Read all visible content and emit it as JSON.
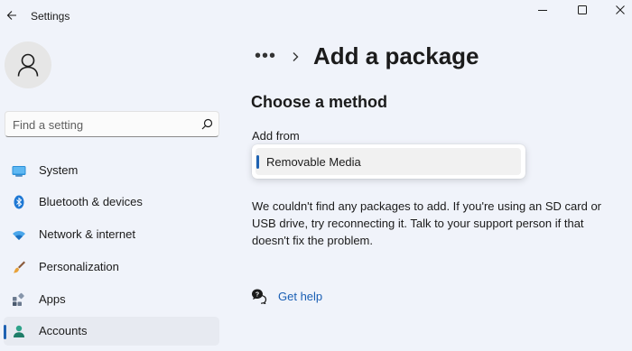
{
  "app": {
    "title": "Settings"
  },
  "window_controls": {
    "minimize": "minimize",
    "maximize": "maximize",
    "close": "close"
  },
  "search": {
    "placeholder": "Find a setting",
    "value": ""
  },
  "sidebar": {
    "items": [
      {
        "label": "System",
        "icon": "monitor-icon",
        "selected": false
      },
      {
        "label": "Bluetooth & devices",
        "icon": "bluetooth-icon",
        "selected": false
      },
      {
        "label": "Network & internet",
        "icon": "wifi-icon",
        "selected": false
      },
      {
        "label": "Personalization",
        "icon": "brush-icon",
        "selected": false
      },
      {
        "label": "Apps",
        "icon": "apps-icon",
        "selected": false
      },
      {
        "label": "Accounts",
        "icon": "accounts-icon",
        "selected": true
      }
    ]
  },
  "main": {
    "breadcrumb_more": "•••",
    "page_title": "Add a package",
    "section_title": "Choose a method",
    "add_from_label": "Add from",
    "selected_option": "Removable Media",
    "message": "We couldn't find any packages to add. If you're using an SD card or USB drive, try reconnecting it. Talk to your support person if that doesn't fix the problem.",
    "help_link": "Get help"
  },
  "colors": {
    "background": "#f0f3fa",
    "accent": "#1f62b2",
    "link": "#1a5fb4"
  }
}
